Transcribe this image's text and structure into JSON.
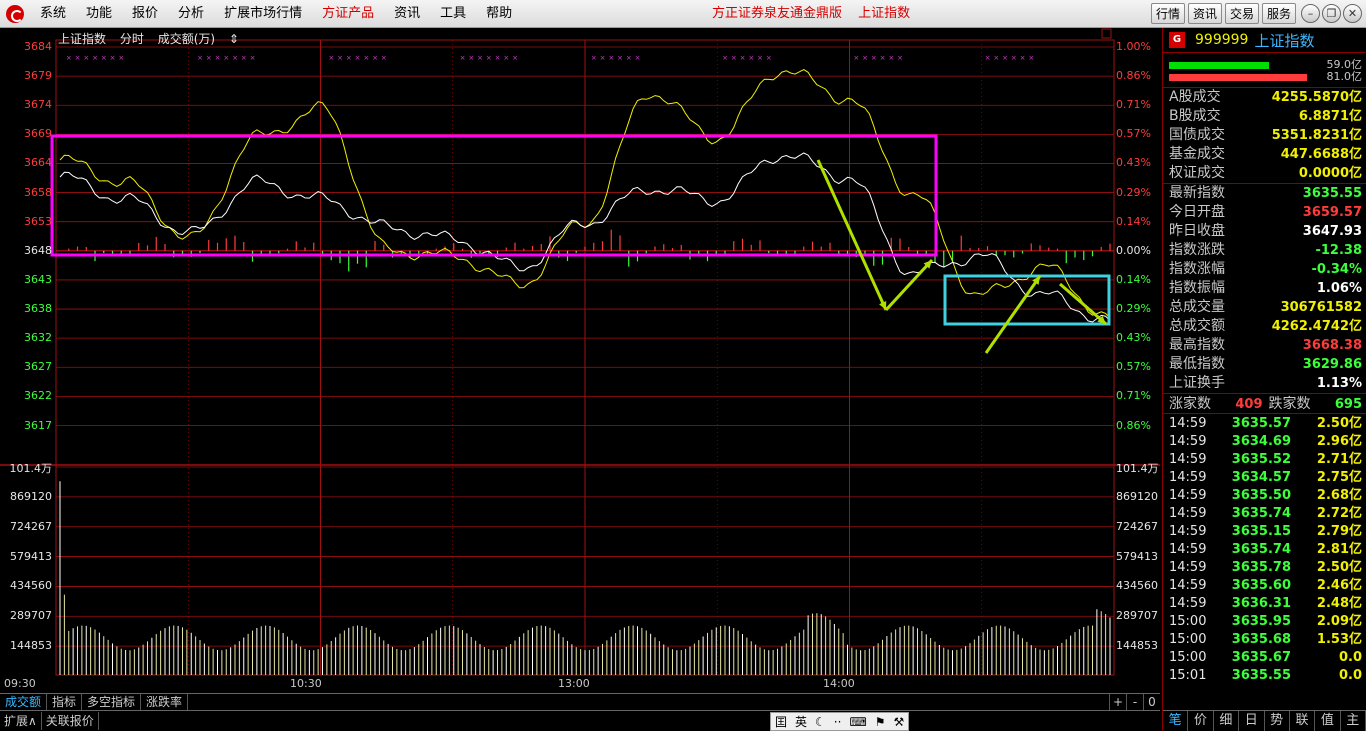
{
  "menubar": {
    "items": [
      "系统",
      "功能",
      "报价",
      "分析",
      "扩展市场行情",
      "方证产品",
      "资讯",
      "工具",
      "帮助"
    ],
    "center_items": [
      "方正证券泉友通金鼎版",
      "上证指数"
    ],
    "right_buttons": [
      "行情",
      "资讯",
      "交易",
      "服务"
    ]
  },
  "chart": {
    "title": "上证指数",
    "mode": "分时",
    "indicator": "成交额(万)",
    "price_axis": [
      "3684",
      "3679",
      "3674",
      "3669",
      "3664",
      "3658",
      "3653",
      "3648",
      "3643",
      "3638",
      "3632",
      "3627",
      "3622",
      "3617"
    ],
    "pct_axis": [
      "1.00%",
      "0.86%",
      "0.71%",
      "0.57%",
      "0.43%",
      "0.29%",
      "0.14%",
      "0.00%",
      "0.14%",
      "0.29%",
      "0.43%",
      "0.57%",
      "0.71%",
      "0.86%"
    ],
    "vol_axis": [
      "101.4万",
      "869120",
      "724267",
      "579413",
      "434560",
      "289707",
      "144853"
    ],
    "time_axis": [
      "09:30",
      "10:30",
      "13:00",
      "14:00"
    ],
    "colors": {
      "up": "#ff3c3c",
      "down": "#3cff3c",
      "price_line": "#ffffff",
      "avg_line": "#f0f000",
      "box1": "#ff00ff",
      "box2": "#40d0e0",
      "arrow": "#b0e000"
    }
  },
  "chart_data": {
    "type": "line",
    "title": "上证指数",
    "ylabel": "",
    "xlabel": "",
    "ylim": [
      3612.5,
      3684
    ],
    "prev_close": 3647.93,
    "x": [
      "09:30",
      "09:45",
      "10:00",
      "10:15",
      "10:30",
      "10:45",
      "11:00",
      "11:15",
      "11:30/13:00",
      "13:15",
      "13:30",
      "13:45",
      "14:00",
      "14:15",
      "14:30",
      "14:45",
      "15:00"
    ],
    "series": [
      {
        "name": "",
        "values": [
          3661,
          3657,
          3651,
          3660,
          3657,
          3652,
          3650,
          3645,
          3653,
          3659,
          3657,
          3665,
          3661,
          3644,
          3647,
          3640,
          3635.55
        ]
      },
      {
        "name": "",
        "values": [
          3664,
          3660,
          3650,
          3668,
          3673,
          3648,
          3647,
          3642,
          3653,
          3676,
          3668,
          3680,
          3675,
          3658,
          3640,
          3645,
          3636
        ]
      }
    ],
    "volume": {
      "x_start": "09:30",
      "x_end": "15:00",
      "ylim": [
        0,
        1014000
      ],
      "first_bar": 940000,
      "typical": 240000
    }
  },
  "panel": {
    "badge": "G",
    "code": "999999",
    "name": "上证指数",
    "bars": [
      {
        "value": "59.0亿",
        "color": "#00e000",
        "width": 100
      },
      {
        "value": "81.0亿",
        "color": "#ff3c3c",
        "width": 138
      }
    ],
    "stats_a": [
      {
        "k": "A股成交",
        "v": "4255.5870亿",
        "c": "y"
      },
      {
        "k": "B股成交",
        "v": "6.8871亿",
        "c": "y"
      },
      {
        "k": "国债成交",
        "v": "5351.8231亿",
        "c": "y"
      },
      {
        "k": "基金成交",
        "v": "447.6688亿",
        "c": "y"
      },
      {
        "k": "权证成交",
        "v": "0.0000亿",
        "c": "y"
      }
    ],
    "stats_b": [
      {
        "k": "最新指数",
        "v": "3635.55",
        "c": "g"
      },
      {
        "k": "今日开盘",
        "v": "3659.57",
        "c": "r"
      },
      {
        "k": "昨日收盘",
        "v": "3647.93",
        "c": "w"
      },
      {
        "k": "指数涨跌",
        "v": "-12.38",
        "c": "g"
      },
      {
        "k": "指数涨幅",
        "v": "-0.34%",
        "c": "g"
      },
      {
        "k": "指数振幅",
        "v": "1.06%",
        "c": "w"
      },
      {
        "k": "总成交量",
        "v": "306761582",
        "c": "y"
      },
      {
        "k": "总成交额",
        "v": "4262.4742亿",
        "c": "y"
      },
      {
        "k": "最高指数",
        "v": "3668.38",
        "c": "r"
      },
      {
        "k": "最低指数",
        "v": "3629.86",
        "c": "g"
      },
      {
        "k": "上证换手",
        "v": "1.13%",
        "c": "w"
      }
    ],
    "up_label": "涨家数",
    "up_value": "409",
    "down_label": "跌家数",
    "down_value": "695",
    "ticks": [
      {
        "t": "14:59",
        "p": "3635.57",
        "a": "2.50亿"
      },
      {
        "t": "14:59",
        "p": "3634.69",
        "a": "2.96亿"
      },
      {
        "t": "14:59",
        "p": "3635.52",
        "a": "2.71亿"
      },
      {
        "t": "14:59",
        "p": "3634.57",
        "a": "2.75亿"
      },
      {
        "t": "14:59",
        "p": "3635.50",
        "a": "2.68亿"
      },
      {
        "t": "14:59",
        "p": "3635.74",
        "a": "2.72亿"
      },
      {
        "t": "14:59",
        "p": "3635.15",
        "a": "2.79亿"
      },
      {
        "t": "14:59",
        "p": "3635.74",
        "a": "2.81亿"
      },
      {
        "t": "14:59",
        "p": "3635.78",
        "a": "2.50亿"
      },
      {
        "t": "14:59",
        "p": "3635.60",
        "a": "2.46亿"
      },
      {
        "t": "14:59",
        "p": "3636.31",
        "a": "2.48亿"
      },
      {
        "t": "15:00",
        "p": "3635.95",
        "a": "2.09亿"
      },
      {
        "t": "15:00",
        "p": "3635.68",
        "a": "1.53亿"
      },
      {
        "t": "15:00",
        "p": "3635.67",
        "a": "0.0"
      },
      {
        "t": "15:01",
        "p": "3635.55",
        "a": "0.0"
      }
    ],
    "tabs": [
      "笔",
      "价",
      "细",
      "日",
      "势",
      "联",
      "值",
      "主"
    ]
  },
  "tabbar": {
    "tabs": [
      "成交额",
      "指标",
      "多空指标",
      "涨跌率"
    ],
    "zoom": [
      "+",
      "-",
      "0"
    ]
  },
  "statusbar": {
    "tabs": [
      "扩展∧",
      "关联报价"
    ],
    "ime": [
      "囯",
      "英",
      "☾",
      "··",
      "⌨",
      "⚑",
      "⚒"
    ]
  }
}
